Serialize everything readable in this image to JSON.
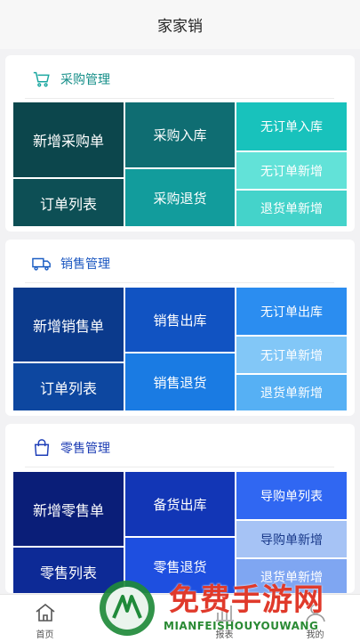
{
  "header": {
    "title": "家家销"
  },
  "sections": [
    {
      "title": "采购管理",
      "icon": "shopping-cart-icon",
      "tiles": {
        "main": "新增采购单",
        "list": "订单列表",
        "in": "采购入库",
        "return": "采购退货",
        "a": "无订单入库",
        "b": "无订单新增",
        "c": "退货单新增"
      }
    },
    {
      "title": "销售管理",
      "icon": "delivery-truck-icon",
      "tiles": {
        "main": "新增销售单",
        "list": "订单列表",
        "in": "销售出库",
        "return": "销售退货",
        "a": "无订单出库",
        "b": "无订单新增",
        "c": "退货单新增"
      }
    },
    {
      "title": "零售管理",
      "icon": "shopping-bag-icon",
      "tiles": {
        "main": "新增零售单",
        "list": "零售列表",
        "in": "备货出库",
        "return": "零售退货",
        "a": "导购单列表",
        "b": "导购单新增",
        "c": "退货单新增"
      }
    }
  ],
  "tabbar": {
    "items": [
      {
        "label": "首页",
        "icon": "home-icon"
      },
      {
        "label": "",
        "icon": "grid-icon"
      },
      {
        "label": "报表",
        "icon": "chart-icon"
      },
      {
        "label": "",
        "icon": "bell-icon"
      },
      {
        "label": "我的",
        "icon": "user-icon"
      }
    ]
  },
  "watermark": {
    "text": "免费手游网",
    "subtext": "MIANFEISHOUYOUWANG"
  },
  "colors": {
    "purchase": [
      "#0d4a4f",
      "#0d5d63",
      "#117a7e",
      "#12a8a8",
      "#19c4bf",
      "#5fe0d6",
      "#3fd0c8"
    ],
    "sales": [
      "#0b3b8f",
      "#0d4ba6",
      "#1156c7",
      "#1a7be3",
      "#2b8df0",
      "#7cc4f7",
      "#52aef4"
    ],
    "retail": [
      "#0a1f7a",
      "#0d2b99",
      "#1237b8",
      "#1e4fe0",
      "#3067f2",
      "#a3c1f5",
      "#7aa3f2"
    ]
  }
}
